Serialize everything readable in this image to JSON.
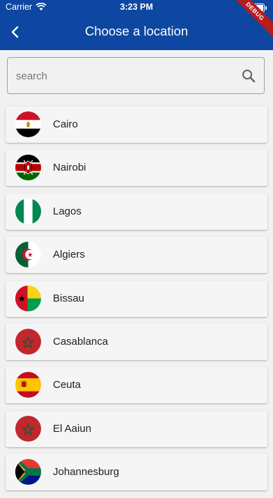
{
  "status_bar": {
    "carrier": "Carrier",
    "time": "3:23 PM"
  },
  "app_bar": {
    "title": "Choose a location",
    "debug_banner": "DEBUG",
    "color": "#0d47a1"
  },
  "search": {
    "placeholder": "search",
    "value": ""
  },
  "locations": [
    {
      "name": "Cairo",
      "flag": "egypt-flag-icon"
    },
    {
      "name": "Nairobi",
      "flag": "kenya-flag-icon"
    },
    {
      "name": "Lagos",
      "flag": "nigeria-flag-icon"
    },
    {
      "name": "Algiers",
      "flag": "algeria-flag-icon"
    },
    {
      "name": "Bissau",
      "flag": "guinea-bissau-flag-icon"
    },
    {
      "name": "Casablanca",
      "flag": "morocco-flag-icon"
    },
    {
      "name": "Ceuta",
      "flag": "spain-flag-icon"
    },
    {
      "name": "El Aaiun",
      "flag": "morocco-flag-icon"
    },
    {
      "name": "Johannesburg",
      "flag": "south-africa-flag-icon"
    }
  ]
}
